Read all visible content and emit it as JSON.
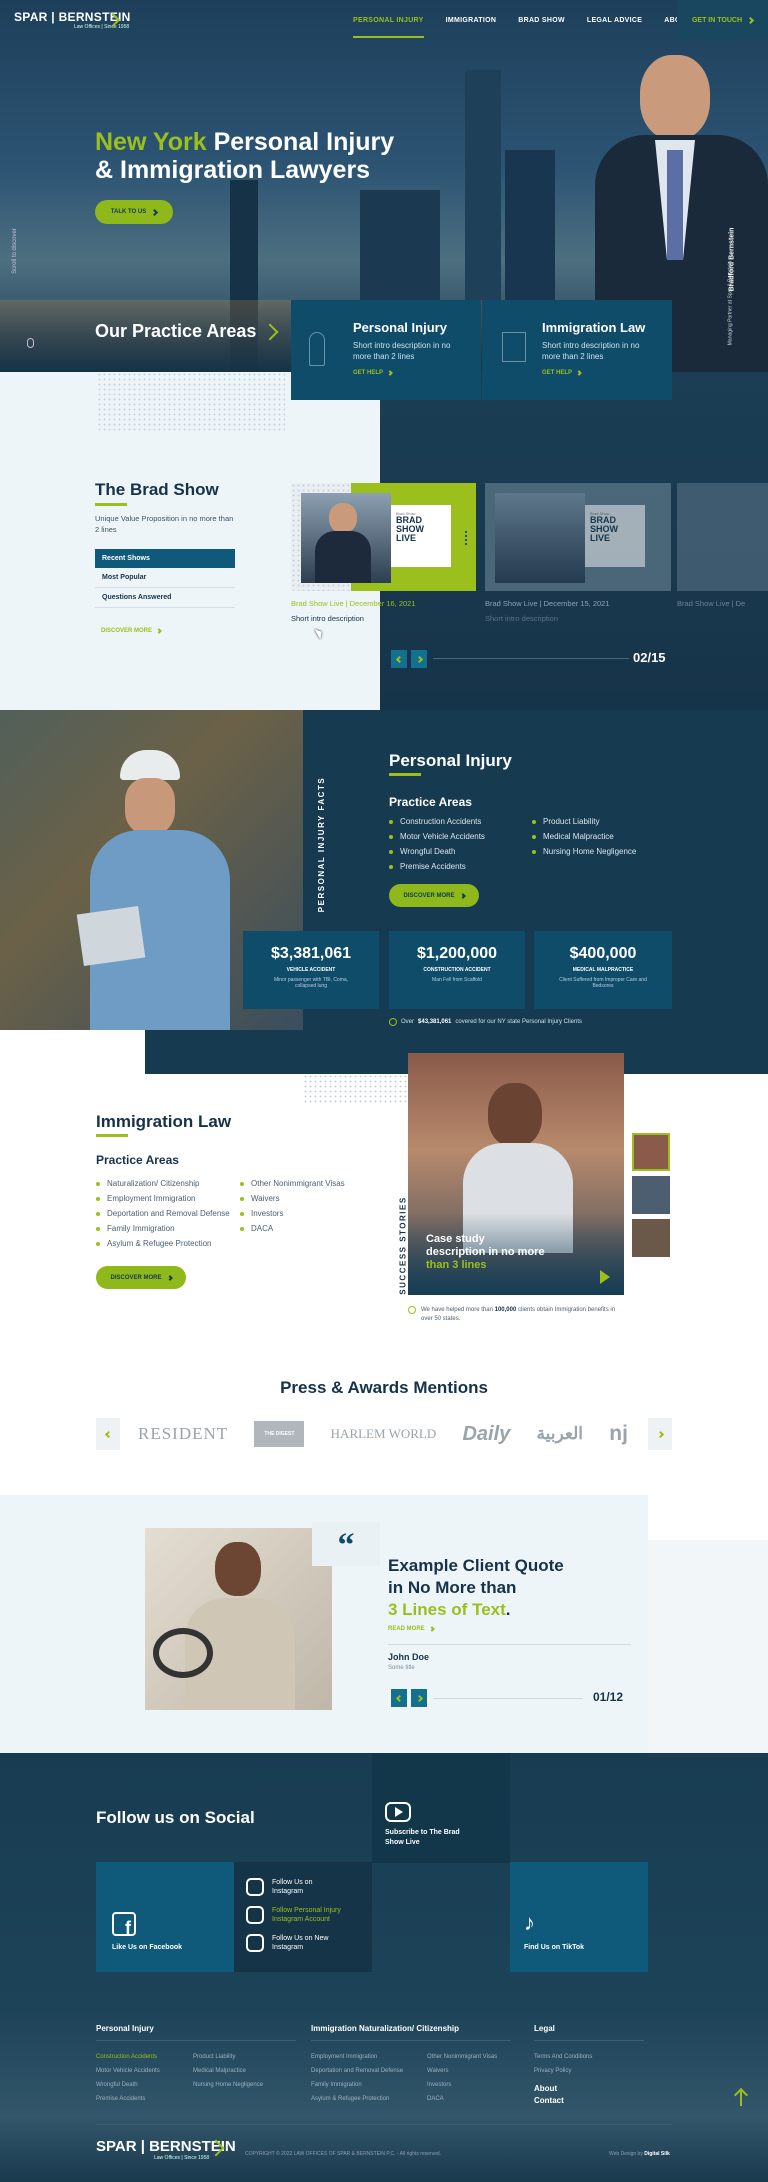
{
  "header": {
    "logo_text": "SPAR | BERNSTEIN",
    "logo_sub": "Law Offices | Since 1958",
    "nav": [
      "PERSONAL INJURY",
      "IMMIGRATION",
      "BRAD SHOW",
      "LEGAL ADVICE",
      "ABOUT"
    ],
    "cta": "GET IN TOUCH"
  },
  "hero": {
    "title_accent": "New York",
    "title_rest": "Personal Injury",
    "title_line2": "& Immigration Lawyers",
    "cta": "TALK TO US",
    "scroll_label": "Scroll to discover",
    "person_name": "Bradford Bernstein",
    "person_role": "Managing Partner at Spar & Bernstein"
  },
  "practice": {
    "heading": "Our Practice Areas",
    "cards": [
      {
        "title": "Personal Injury",
        "desc": "Short intro description in no more than 2 lines",
        "link": "GET HELP"
      },
      {
        "title": "Immigration Law",
        "desc": "Short intro description in no more than 2 lines",
        "link": "GET HELP"
      }
    ]
  },
  "brad": {
    "title": "The Brad Show",
    "subtitle": "Unique Value Proposition in no more than 2 lines",
    "tabs": [
      "Recent Shows",
      "Most Popular",
      "Questions Answered"
    ],
    "discover": "DISCOVER MORE",
    "thumb_label_small": "Brad Show",
    "thumb_label": "BRAD SHOW LIVE",
    "videos": [
      {
        "title": "Brad Show Live | December 16, 2021",
        "desc": "Short intro description"
      },
      {
        "title": "Brad Show Live | December 15, 2021",
        "desc": "Short intro description"
      },
      {
        "title": "Brad Show Live | De",
        "desc": ""
      }
    ],
    "counter": "02/15"
  },
  "pi": {
    "vertical": "PERSONAL INJURY FACTS",
    "title": "Personal Injury",
    "sub": "Practice Areas",
    "left": [
      "Construction Accidents",
      "Motor Vehicle Accidents",
      "Wrongful Death",
      "Premise Accidents"
    ],
    "right": [
      "Product Liability",
      "Medical Malpractice",
      "Nursing Home Negligence"
    ],
    "cta": "DISCOVER MORE",
    "stats": [
      {
        "amount": "$3,381,061",
        "label": "VEHICLE ACCIDENT",
        "desc": "Minor passenger with TBI, Coma, collapsed lung"
      },
      {
        "amount": "$1,200,000",
        "label": "CONSTRUCTION ACCIDENT",
        "desc": "Man Fell from Scaffold"
      },
      {
        "amount": "$400,000",
        "label": "MEDICAL MALPRACTICE",
        "desc": "Client Suffered from Improper Care and Bedsores"
      }
    ],
    "note_pre": "Over",
    "note_bold": "$43,381,061",
    "note_post": "covered for our NY state Personal Injury Clients"
  },
  "imm": {
    "title": "Immigration Law",
    "sub": "Practice Areas",
    "left": [
      "Naturalization/ Citizenship",
      "Employment Immigration",
      "Deportation and Removal Defense",
      "Family Immigration",
      "Asylum & Refugee Protection"
    ],
    "right": [
      "Other Nonimmigrant Visas",
      "Waivers",
      "Investors",
      "DACA"
    ],
    "cta": "DISCOVER MORE",
    "vertical": "SUCCESS STORIES",
    "case_text": "Case study description in no more",
    "case_accent": "than 3 lines",
    "note_pre": "We have helped more than",
    "note_bold": "100,000",
    "note_post": "clients obtain Immigration benefits in over 50 states."
  },
  "press": {
    "title": "Press & Awards Mentions",
    "logos": [
      "RESIDENT",
      "HARLEM WORLD",
      "Daily",
      "العربية",
      "nj"
    ],
    "logo_sub": "THE DIGEST"
  },
  "quote": {
    "line1": "Example Client Quote",
    "line2": "in No More than",
    "accent": "3 Lines of Text",
    "period": ".",
    "read": "READ MORE",
    "name": "John Doe",
    "role": "Some title",
    "counter": "01/12"
  },
  "social": {
    "title": "Follow us on Social",
    "youtube": "Subscribe to The Brad Show Live",
    "facebook": "Like Us on Facebook",
    "tiktok": "Find Us on TikTok",
    "instagram": [
      "Follow Us on Instagram",
      "Follow Personal Injury Instagram Account",
      "Follow Us on New Instagram"
    ]
  },
  "footer": {
    "col1_title": "Personal Injury",
    "col1_a": [
      "Construction Accidents",
      "Motor Vehicle Accidents",
      "Wrongful Death",
      "Premise Accidents"
    ],
    "col1_b": [
      "Product Liability",
      "Medical Malpractice",
      "Nursing Home Negligence"
    ],
    "col2_title": "Immigration Naturalization/ Citizenship",
    "col2_a": [
      "Employment Immigration",
      "Deportation and Removal Defense",
      "Family Immigration",
      "Asylum & Refugee Protection"
    ],
    "col2_b": [
      "Other Nonimmigrant Visas",
      "Waivers",
      "Investors",
      "DACA"
    ],
    "col3_title": "Legal",
    "col3": [
      "Terms And Conditions",
      "Privacy Policy"
    ],
    "about": "About",
    "contact": "Contact",
    "copyright": "COPYRIGHT © 2022 LAW OFFICES OF SPAR & BERNSTEIN P.C. - All rights reserved.",
    "credit_pre": "Web Design by",
    "credit": "Digital Silk"
  }
}
